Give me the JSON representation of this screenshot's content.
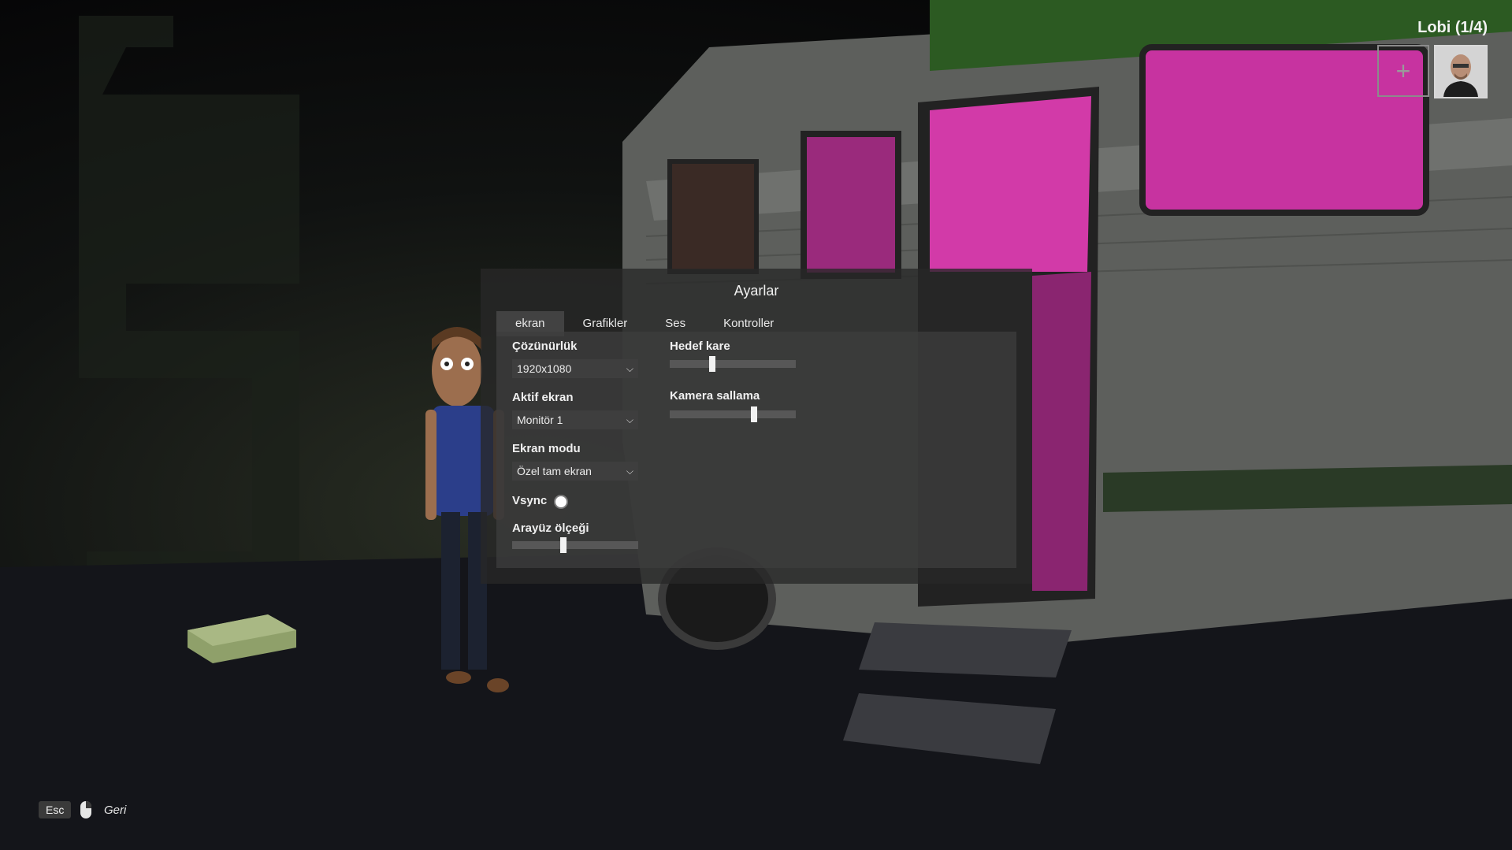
{
  "lobby": {
    "title": "Lobi (1/4)",
    "add_slot_icon": "plus-icon"
  },
  "settings": {
    "title": "Ayarlar",
    "tabs": [
      {
        "label": "ekran",
        "active": true
      },
      {
        "label": "Grafikler",
        "active": false
      },
      {
        "label": "Ses",
        "active": false
      },
      {
        "label": "Kontroller",
        "active": false
      }
    ],
    "resolution": {
      "label": "Çözünürlük",
      "value": "1920x1080"
    },
    "active_screen": {
      "label": "Aktif ekran",
      "value": "Monitör 1"
    },
    "screen_mode": {
      "label": "Ekran modu",
      "value": "Özel tam ekran"
    },
    "vsync": {
      "label": "Vsync",
      "enabled": false
    },
    "ui_scale": {
      "label": "Arayüz ölçeği",
      "level": 0.4
    },
    "target_frame": {
      "label": "Hedef kare",
      "level": 0.33
    },
    "camera_shake": {
      "label": "Kamera sallama",
      "level": 0.68
    }
  },
  "footer": {
    "esc_key": "Esc",
    "back_label": "Geri",
    "mouse_icon": "mouse-right-click-icon"
  },
  "colors": {
    "panel_bg": "#282828",
    "rv_interior": "#d23aa8"
  }
}
